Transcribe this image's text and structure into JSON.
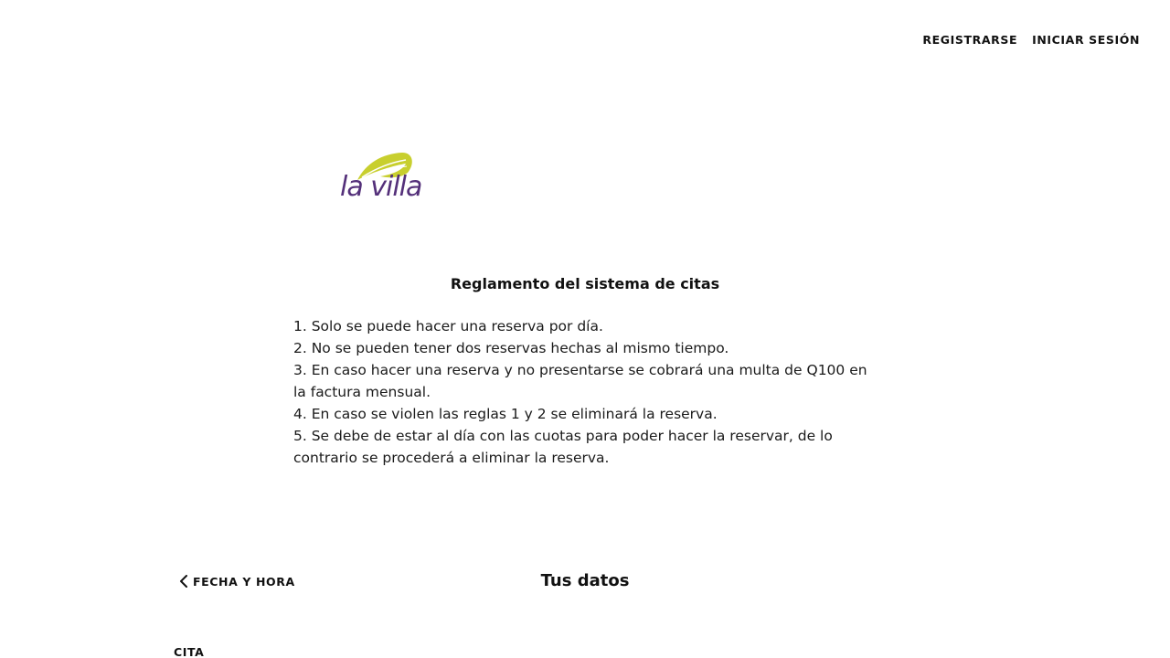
{
  "nav": {
    "register_label": "REGISTRARSE",
    "login_label": "INICIAR SESIÓN"
  },
  "logo": {
    "text": "la villa",
    "text_color": "#54307a",
    "leaf_color": "#c8cf2e"
  },
  "rules": {
    "title": "Reglamento del sistema de citas",
    "items": [
      "1. Solo se puede hacer una reserva por día.",
      "2. No se pueden tener dos reservas hechas al mismo tiempo.",
      "3. En caso hacer una reserva y no presentarse se cobrará una multa de Q100 en la factura mensual.",
      "4. En caso se violen las reglas 1 y 2 se eliminará la reserva.",
      "5. Se debe de estar al día con las cuotas para poder hacer la reservar, de lo contrario se procederá a eliminar la reserva."
    ]
  },
  "step_nav": {
    "back_label": "FECHA Y HORA",
    "back_icon": "chevron-left-icon",
    "title": "Tus datos"
  },
  "appointment": {
    "label": "CITA"
  }
}
